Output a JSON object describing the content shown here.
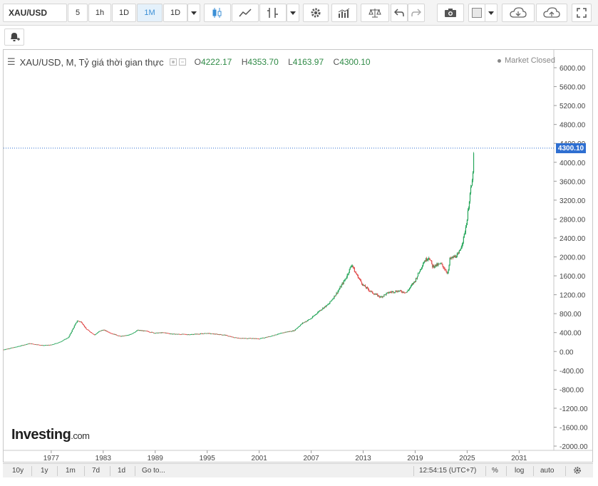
{
  "toolbar": {
    "symbol": "XAU/USD",
    "intervals": [
      "5",
      "1h",
      "1D",
      "1M",
      "1D"
    ],
    "active_interval": "1M"
  },
  "legend": {
    "title": "XAU/USD, M, Tỷ giá thời gian thực",
    "o_label": "O",
    "o_value": "4222.17",
    "h_label": "H",
    "h_value": "4353.70",
    "l_label": "L",
    "l_value": "4163.97",
    "c_label": "C",
    "c_value": "4300.10"
  },
  "status": "Market Closed",
  "logo": {
    "main": "Investing",
    "suffix": ".com"
  },
  "bottom_bar": {
    "ranges": [
      "10y",
      "1y",
      "1m",
      "7d",
      "1d"
    ],
    "goto": "Go to...",
    "clock": "12:54:15 (UTC+7)",
    "percent": "%",
    "log": "log",
    "auto": "auto"
  },
  "colors": {
    "up": "#26a65b",
    "down": "#e04b4b",
    "accent": "#3b8fd6",
    "price_tag": "#2f6fd1"
  },
  "chart_data": {
    "type": "line",
    "title": "XAU/USD, M, Tỷ giá thời gian thực",
    "xlabel": "",
    "ylabel": "",
    "ylim": [
      -2000,
      6000
    ],
    "y_ticks": [
      "6000.00",
      "5600.00",
      "5200.00",
      "4800.00",
      "4400.00",
      "4000.00",
      "3600.00",
      "3200.00",
      "2800.00",
      "2400.00",
      "2000.00",
      "1600.00",
      "1200.00",
      "800.00",
      "400.00",
      "0.00",
      "-400.00",
      "-800.00",
      "-1200.00",
      "-1600.00",
      "-2000.00"
    ],
    "x_ticks": [
      "1977",
      "1983",
      "1989",
      "1995",
      "2001",
      "2007",
      "2013",
      "2019",
      "2025",
      "2031"
    ],
    "x_range": [
      1971.5,
      2035
    ],
    "last_price": "4300.10",
    "series": [
      {
        "x": [
          1971.5,
          1973,
          1974.5,
          1976,
          1977,
          1978,
          1979,
          1979.5,
          1980,
          1980.5,
          1981,
          1982,
          1982.5,
          1983,
          1984,
          1985,
          1986,
          1987,
          1988,
          1989,
          1990,
          1991,
          1993,
          1995,
          1997,
          1998,
          1999,
          2000,
          2001,
          2002,
          2003,
          2004,
          2005,
          2006,
          2007,
          2008,
          2009,
          2010,
          2011,
          2011.7,
          2012,
          2013,
          2014,
          2015,
          2016,
          2017,
          2018,
          2019,
          2020,
          2020.6,
          2021,
          2022,
          2022.8,
          2023,
          2024,
          2024.6,
          2025,
          2025.3,
          2025.6,
          2025.8
        ],
        "y": [
          40,
          100,
          170,
          130,
          140,
          200,
          300,
          480,
          650,
          620,
          480,
          350,
          420,
          460,
          380,
          320,
          350,
          450,
          430,
          390,
          400,
          370,
          360,
          385,
          350,
          300,
          280,
          280,
          270,
          310,
          360,
          410,
          440,
          600,
          700,
          870,
          1000,
          1250,
          1550,
          1850,
          1700,
          1400,
          1250,
          1150,
          1250,
          1280,
          1250,
          1500,
          1900,
          2000,
          1800,
          1850,
          1650,
          1950,
          2050,
          2400,
          2800,
          3300,
          3600,
          4300
        ]
      }
    ]
  }
}
